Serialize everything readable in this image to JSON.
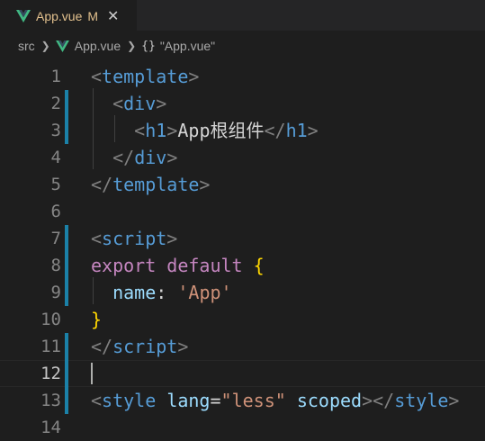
{
  "tab": {
    "title": "App.vue",
    "badge": "M",
    "close_glyph": "✕",
    "icon": "vue-icon"
  },
  "breadcrumb": {
    "folder": "src",
    "file": "App.vue",
    "symbol_icon": "{}",
    "symbol": "\"App.vue\""
  },
  "editor": {
    "active_line": 12,
    "lines": [
      {
        "n": "1",
        "mark": false,
        "tokens": [
          [
            "punc",
            "<"
          ],
          [
            "tag",
            "template"
          ],
          [
            "punc",
            ">"
          ]
        ]
      },
      {
        "n": "2",
        "mark": true,
        "tokens": [
          [
            "ws",
            "  "
          ],
          [
            "punc",
            "<"
          ],
          [
            "tag",
            "div"
          ],
          [
            "punc",
            ">"
          ]
        ]
      },
      {
        "n": "3",
        "mark": true,
        "tokens": [
          [
            "ws",
            "    "
          ],
          [
            "punc",
            "<"
          ],
          [
            "tag",
            "h1"
          ],
          [
            "punc",
            ">"
          ],
          [
            "text",
            "App根组件"
          ],
          [
            "punc",
            "</"
          ],
          [
            "tag",
            "h1"
          ],
          [
            "punc",
            ">"
          ]
        ]
      },
      {
        "n": "4",
        "mark": false,
        "tokens": [
          [
            "ws",
            "  "
          ],
          [
            "punc",
            "</"
          ],
          [
            "tag",
            "div"
          ],
          [
            "punc",
            ">"
          ]
        ]
      },
      {
        "n": "5",
        "mark": false,
        "tokens": [
          [
            "punc",
            "</"
          ],
          [
            "tag",
            "template"
          ],
          [
            "punc",
            ">"
          ]
        ]
      },
      {
        "n": "6",
        "mark": false,
        "tokens": []
      },
      {
        "n": "7",
        "mark": true,
        "tokens": [
          [
            "punc",
            "<"
          ],
          [
            "tag",
            "script"
          ],
          [
            "punc",
            ">"
          ]
        ]
      },
      {
        "n": "8",
        "mark": true,
        "tokens": [
          [
            "kw",
            "export"
          ],
          [
            "ws",
            " "
          ],
          [
            "kw",
            "default"
          ],
          [
            "ws",
            " "
          ],
          [
            "brace",
            "{"
          ]
        ]
      },
      {
        "n": "9",
        "mark": true,
        "tokens": [
          [
            "ws",
            "  "
          ],
          [
            "prop",
            "name"
          ],
          [
            "text",
            ": "
          ],
          [
            "str",
            "'App'"
          ]
        ]
      },
      {
        "n": "10",
        "mark": false,
        "tokens": [
          [
            "brace",
            "}"
          ]
        ]
      },
      {
        "n": "11",
        "mark": true,
        "tokens": [
          [
            "punc",
            "</"
          ],
          [
            "tag",
            "script"
          ],
          [
            "punc",
            ">"
          ]
        ]
      },
      {
        "n": "12",
        "mark": true,
        "tokens": []
      },
      {
        "n": "13",
        "mark": true,
        "tokens": [
          [
            "punc",
            "<"
          ],
          [
            "tag",
            "style"
          ],
          [
            "ws",
            " "
          ],
          [
            "attr",
            "lang"
          ],
          [
            "text",
            "="
          ],
          [
            "str",
            "\"less\""
          ],
          [
            "ws",
            " "
          ],
          [
            "attr",
            "scoped"
          ],
          [
            "punc",
            "></"
          ],
          [
            "tag",
            "style"
          ],
          [
            "punc",
            ">"
          ]
        ]
      },
      {
        "n": "14",
        "mark": false,
        "tokens": []
      }
    ]
  },
  "colors": {
    "background": "#1e1e1e",
    "tag": "#569cd6",
    "keyword": "#c586c0",
    "string": "#ce9178",
    "property": "#9cdcfe",
    "vue_green": "#41b883",
    "git_modified": "#1b81a8"
  }
}
